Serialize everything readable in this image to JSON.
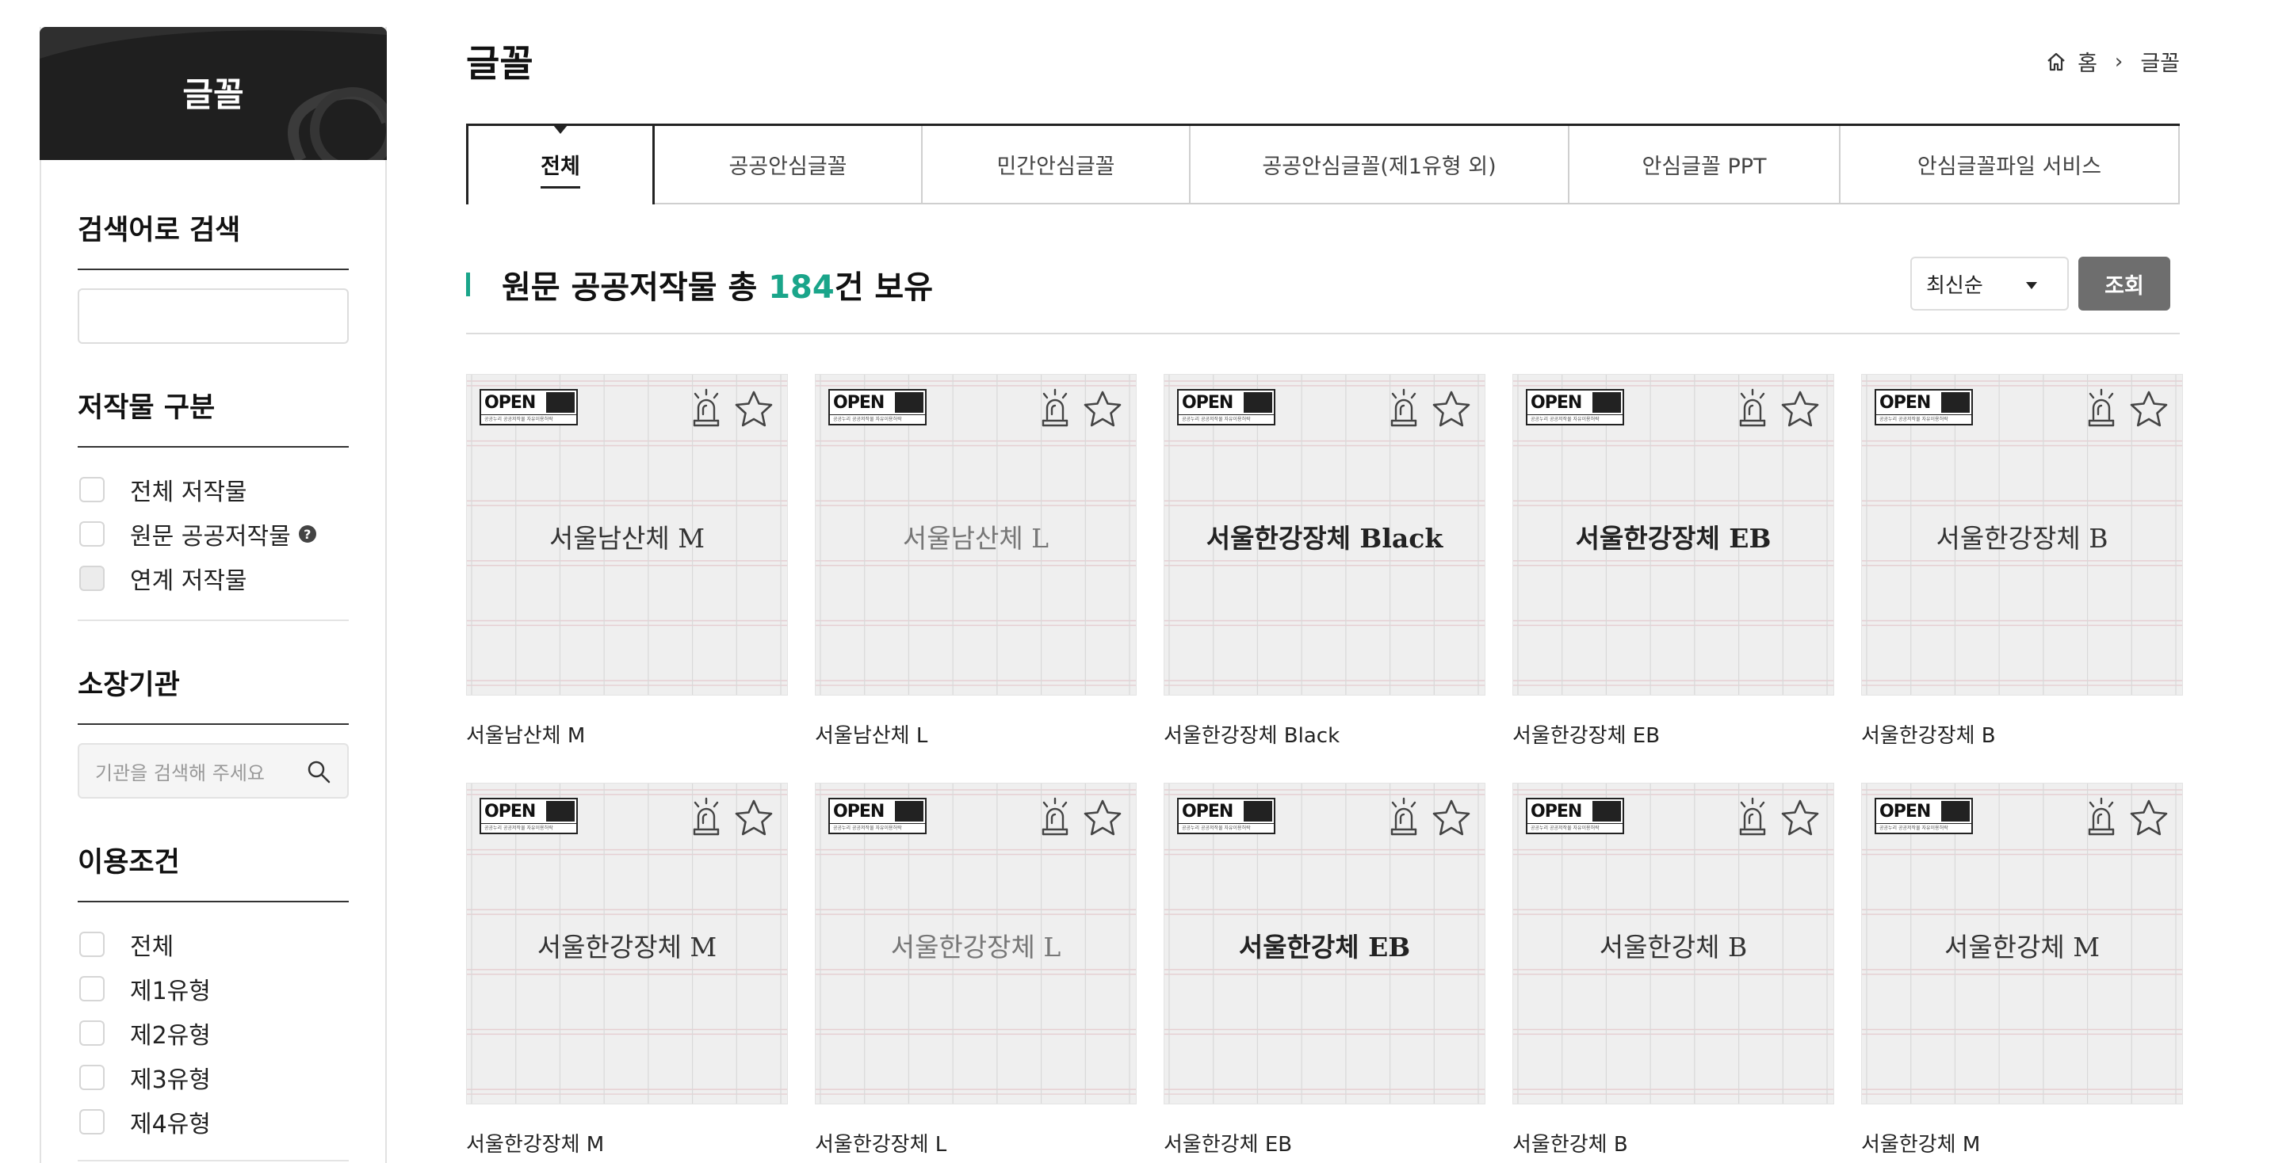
{
  "sidebar": {
    "title": "글꼴",
    "keyword_search": {
      "heading": "검색어로 검색",
      "value": ""
    },
    "category": {
      "heading": "저작물 구분",
      "options": [
        "전체 저작물",
        "원문 공공저작물",
        "연계 저작물"
      ]
    },
    "institution": {
      "heading": "소장기관",
      "placeholder": "기관을 검색해 주세요"
    },
    "license": {
      "heading": "이용조건",
      "options": [
        "전체",
        "제1유형",
        "제2유형",
        "제3유형",
        "제4유형"
      ]
    }
  },
  "page": {
    "title": "글꼴"
  },
  "breadcrumb": {
    "home": "홈",
    "current": "글꼴"
  },
  "tabs": [
    "전체",
    "공공안심글꼴",
    "민간안심글꼴",
    "공공안심글꼴(제1유형 외)",
    "안심글꼴 PPT",
    "안심글꼴파일 서비스"
  ],
  "summary": {
    "prefix": "원문 공공저작물 총 ",
    "count": "184",
    "suffix": "건 보유"
  },
  "sort": {
    "selected": "최신순"
  },
  "search_button": "조회",
  "badge": {
    "open": "OPEN",
    "caption": "공공누리 공공저작물 자유이용허락"
  },
  "cards": [
    {
      "sample": "서울남산체 M",
      "name": "서울남산체 M",
      "weight": "regular"
    },
    {
      "sample": "서울남산체 L",
      "name": "서울남산체 L",
      "weight": "light"
    },
    {
      "sample": "서울한강장체 Black",
      "name": "서울한강장체 Black",
      "weight": "bold"
    },
    {
      "sample": "서울한강장체 EB",
      "name": "서울한강장체 EB",
      "weight": "bold"
    },
    {
      "sample": "서울한강장체 B",
      "name": "서울한강장체 B",
      "weight": "regular"
    },
    {
      "sample": "서울한강장체 M",
      "name": "서울한강장체 M",
      "weight": "regular"
    },
    {
      "sample": "서울한강장체 L",
      "name": "서울한강장체 L",
      "weight": "light"
    },
    {
      "sample": "서울한강체 EB",
      "name": "서울한강체 EB",
      "weight": "bold"
    },
    {
      "sample": "서울한강체 B",
      "name": "서울한강체 B",
      "weight": "regular"
    },
    {
      "sample": "서울한강체 M",
      "name": "서울한강체 M",
      "weight": "regular"
    }
  ],
  "colors": {
    "accent": "#1aa58a",
    "button": "#6e6e6e",
    "header": "#1f1f1f"
  }
}
